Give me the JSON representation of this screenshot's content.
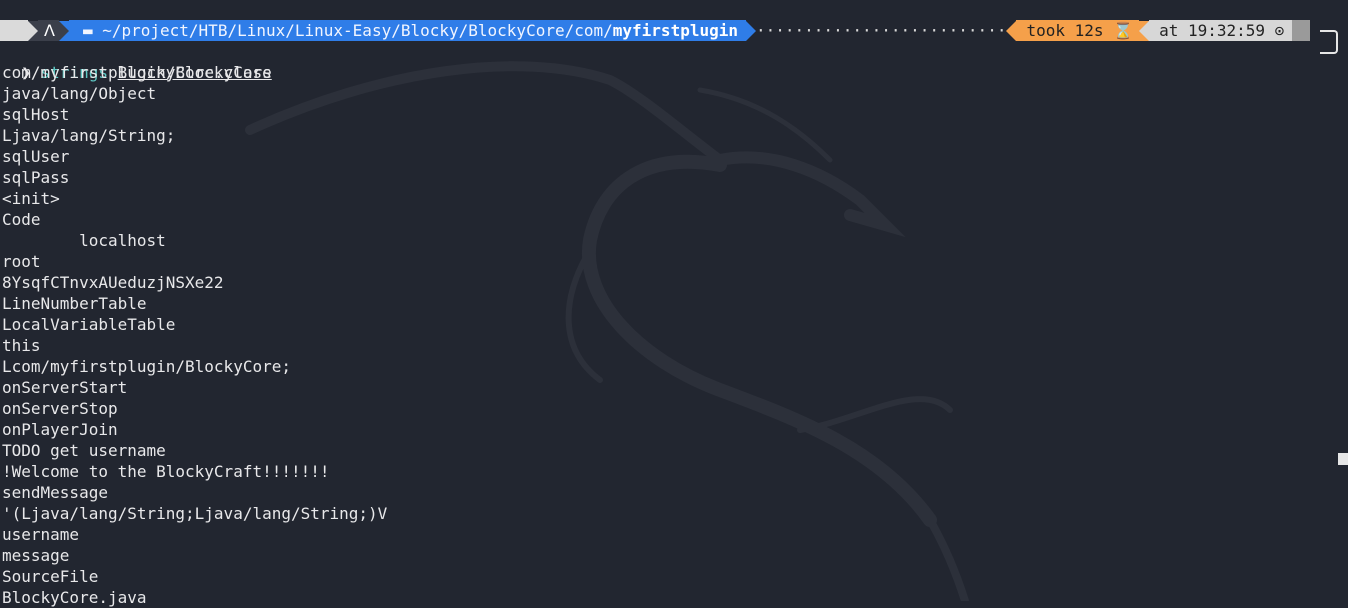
{
  "prompt": {
    "os_icon": "kali-dragon-icon",
    "folder_icon": "folder-icon",
    "path_prefix": "~/project/HTB/Linux/Linux-Easy/Blocky/BlockyCore/com/",
    "path_last": "myfirstplugin",
    "filler": "··························",
    "took": "took 12s ⌛",
    "time": "at 19:32:59 ⊙"
  },
  "command": {
    "prompt_symbol": "❯",
    "name": "strings",
    "argument": "BlockyCore.class"
  },
  "output_lines": [
    "com/myfirstplugin/BlockyCore",
    "java/lang/Object",
    "sqlHost",
    "Ljava/lang/String;",
    "sqlUser",
    "sqlPass",
    "<init>",
    "Code",
    "\tlocalhost",
    "root",
    "8YsqfCTnvxAUeduzjNSXe22",
    "LineNumberTable",
    "LocalVariableTable",
    "this",
    "Lcom/myfirstplugin/BlockyCore;",
    "onServerStart",
    "onServerStop",
    "onPlayerJoin",
    "TODO get username",
    "!Welcome to the BlockyCraft!!!!!!!",
    "sendMessage",
    "'(Ljava/lang/String;Ljava/lang/String;)V",
    "username",
    "message",
    "SourceFile",
    "BlockyCore.java"
  ],
  "colors": {
    "background": "#222630",
    "path_segment": "#2f7de8",
    "duration_segment": "#f5a04a",
    "time_segment": "#d7d7d7",
    "command": "#5fc9c5"
  }
}
